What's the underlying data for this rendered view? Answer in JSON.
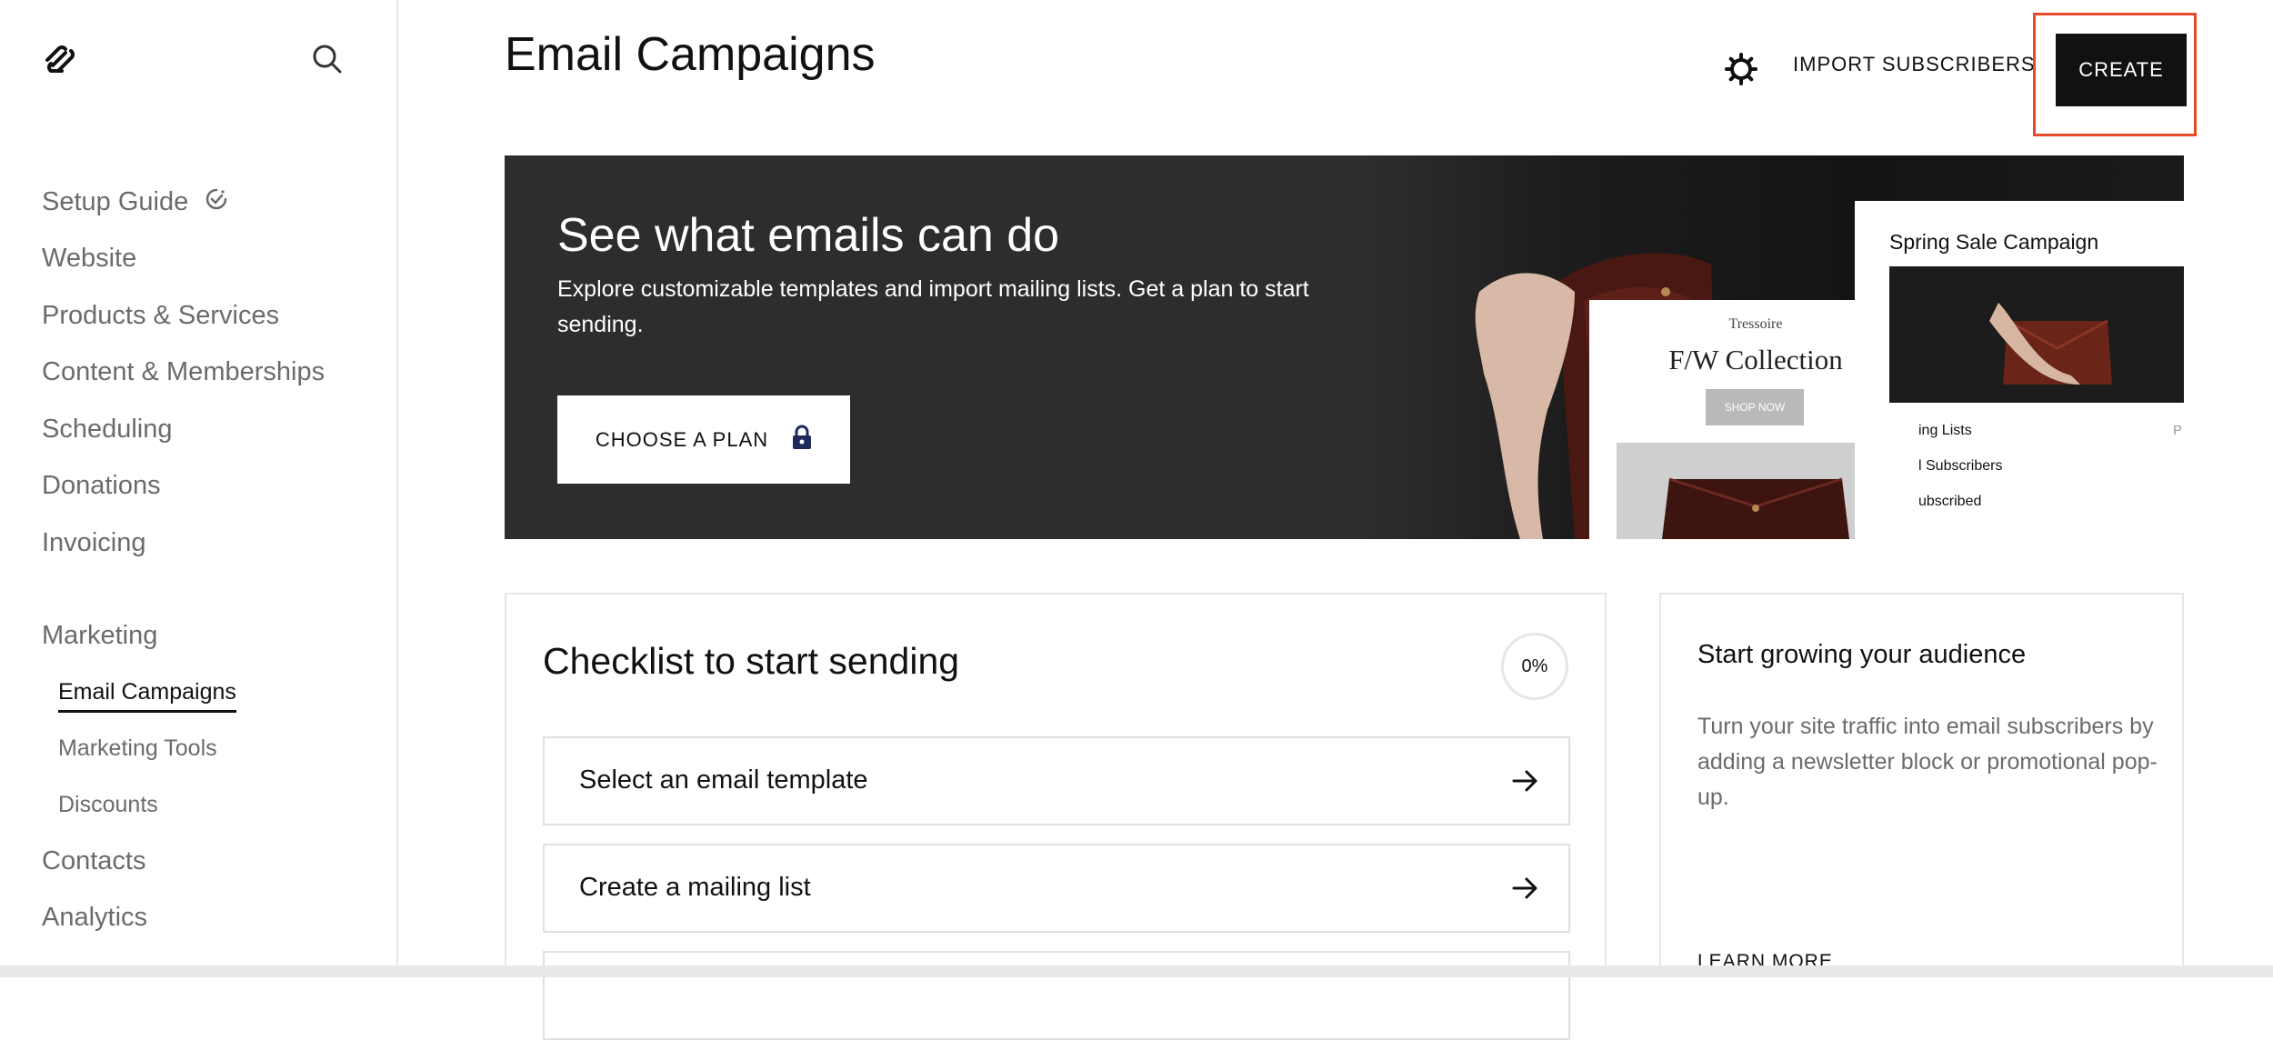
{
  "sidebar": {
    "search_icon": "search-icon",
    "logo": "squarespace-logo",
    "items": [
      {
        "label": "Setup Guide"
      },
      {
        "label": "Website"
      },
      {
        "label": "Products & Services"
      },
      {
        "label": "Content & Memberships"
      },
      {
        "label": "Scheduling"
      },
      {
        "label": "Donations"
      },
      {
        "label": "Invoicing"
      },
      {
        "label": "Marketing"
      },
      {
        "label": "Contacts"
      },
      {
        "label": "Analytics"
      }
    ],
    "marketing_sub": [
      {
        "label": "Email Campaigns",
        "active": true
      },
      {
        "label": "Marketing Tools"
      },
      {
        "label": "Discounts"
      }
    ]
  },
  "header": {
    "title": "Email Campaigns",
    "import_label": "IMPORT SUBSCRIBERS",
    "create_label": "CREATE"
  },
  "hero": {
    "title": "See what emails can do",
    "text": "Explore customizable templates and import mailing lists. Get a plan to start sending.",
    "button_label": "CHOOSE A PLAN",
    "fw_card": {
      "brand": "Tressoire",
      "title": "F/W Collection",
      "shop": "SHOP NOW"
    },
    "spring_card": {
      "title": "Spring Sale Campaign",
      "rows": [
        "ing Lists",
        "l Subscribers",
        "ubscribed"
      ],
      "p": "P"
    }
  },
  "checklist": {
    "title": "Checklist to start sending",
    "progress": "0%",
    "items": [
      {
        "label": "Select an email template"
      },
      {
        "label": "Create a mailing list"
      }
    ]
  },
  "audience": {
    "title": "Start growing your audience",
    "text": "Turn your site traffic into email subscribers by adding a newsletter block or promotional pop-up.",
    "learn_more": "LEARN MORE"
  },
  "colors": {
    "accent_highlight": "#e74a2a",
    "hero_bg": "#2d2d2d",
    "create_bg": "#111111",
    "lock_icon": "#1e2a5a"
  }
}
